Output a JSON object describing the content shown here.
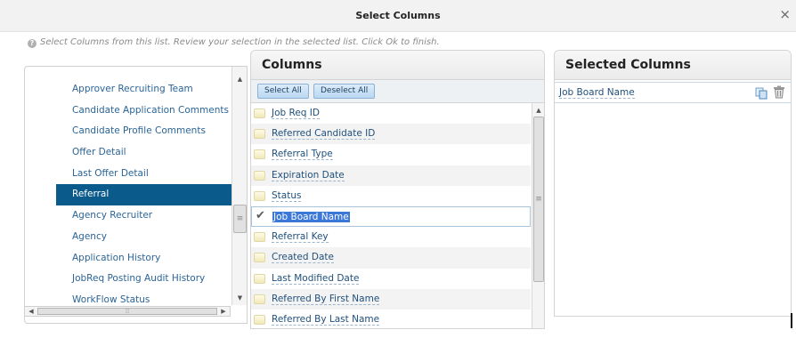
{
  "dialog": {
    "title": "Select Columns",
    "close_glyph": "×",
    "hint": "Select Columns from this list. Review your selection in the selected list. Click Ok to finish."
  },
  "categories": {
    "items": [
      "Approver Recruiting Team",
      "Candidate Application Comments",
      "Candidate Profile Comments",
      "Offer Detail",
      "Last Offer Detail",
      "Referral",
      "Agency Recruiter",
      "Agency",
      "Application History",
      "JobReq Posting Audit History",
      "WorkFlow Status"
    ],
    "selected": "Referral"
  },
  "columns": {
    "title": "Columns",
    "select_all": "Select All",
    "deselect_all": "Deselect All",
    "items": [
      {
        "label": "Job Req ID",
        "checked": false
      },
      {
        "label": "Referred Candidate ID",
        "checked": false
      },
      {
        "label": "Referral Type",
        "checked": false
      },
      {
        "label": "Expiration Date",
        "checked": false
      },
      {
        "label": "Status",
        "checked": false
      },
      {
        "label": "Job Board Name",
        "checked": true
      },
      {
        "label": "Referral Key",
        "checked": false
      },
      {
        "label": "Created Date",
        "checked": false
      },
      {
        "label": "Last Modified Date",
        "checked": false
      },
      {
        "label": "Referred By First Name",
        "checked": false
      },
      {
        "label": "Referred By Last Name",
        "checked": false
      }
    ]
  },
  "selected_columns": {
    "title": "Selected Columns",
    "items": [
      "Job Board Name"
    ]
  },
  "icons": {
    "help": "help-circle-icon",
    "copy": "copy-icon",
    "trash": "trash-icon",
    "check": "checkmark-icon"
  },
  "colors": {
    "accent": "#0a5a8c",
    "link": "#2a6496",
    "highlight": "#3b78d8"
  }
}
